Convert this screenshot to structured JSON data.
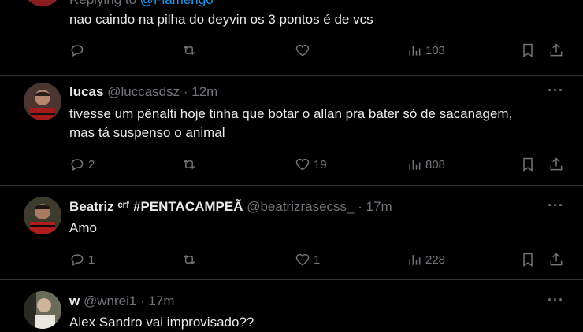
{
  "top_tweet": {
    "replying_prefix": "Replying to",
    "replying_handle": "@Flamengo",
    "text": "nao caindo na pilha do deyvin os 3 pontos é de vcs",
    "views": "103"
  },
  "tweets": [
    {
      "name": "lucas",
      "handle": "@luccasdsz",
      "time": "· 12m",
      "text_line1": "tivesse um pênalti hoje tinha que botar o allan pra bater só de sacanagem,",
      "text_line2": "mas tá suspenso o animal",
      "replies": "2",
      "likes": "19",
      "views": "808"
    },
    {
      "name": "Beatriz ᶜʳᶠ #PENTACAMPEÃ",
      "handle": "@beatrizrasecss_",
      "time": "· 17m",
      "text_line1": "Amo",
      "replies": "1",
      "likes": "1",
      "views": "228"
    },
    {
      "name": "w",
      "handle": "@wnrei1",
      "time": "· 17m",
      "text_line1": "Alex Sandro vai improvisado??"
    }
  ],
  "more_label": "···",
  "colors": {
    "background": "#000000",
    "text": "#e7e9ea",
    "muted": "#71767b",
    "link": "#1d9bf0",
    "divider": "#2f3336"
  }
}
